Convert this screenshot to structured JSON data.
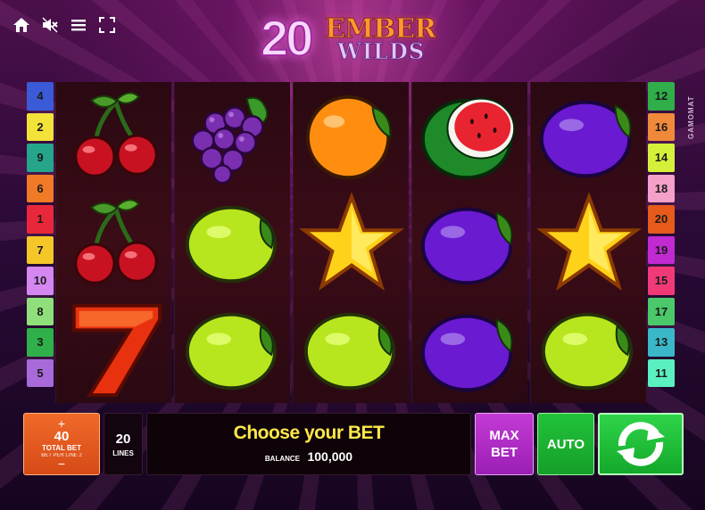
{
  "game": {
    "logo_number": "20",
    "logo_word1": "EMBER",
    "logo_word2": "WILDS",
    "brand": "GAMOMAT"
  },
  "top_icons": [
    "home-icon",
    "mute-icon",
    "menu-icon",
    "fullscreen-icon"
  ],
  "lines_left": [
    {
      "label": "4",
      "color": "#3a5ad8"
    },
    {
      "label": "2",
      "color": "#f2e23a"
    },
    {
      "label": "9",
      "color": "#25a58a"
    },
    {
      "label": "6",
      "color": "#f07a25"
    },
    {
      "label": "1",
      "color": "#e8283a"
    },
    {
      "label": "7",
      "color": "#f5c628"
    },
    {
      "label": "10",
      "color": "#d487f0"
    },
    {
      "label": "8",
      "color": "#8fe07a"
    },
    {
      "label": "3",
      "color": "#2fb04a"
    },
    {
      "label": "5",
      "color": "#a86ad8"
    }
  ],
  "lines_right": [
    {
      "label": "12",
      "color": "#2fae4a"
    },
    {
      "label": "16",
      "color": "#f08a3a"
    },
    {
      "label": "14",
      "color": "#d6f03a"
    },
    {
      "label": "18",
      "color": "#f4a0c8"
    },
    {
      "label": "20",
      "color": "#e65a1a"
    },
    {
      "label": "19",
      "color": "#c02ad0"
    },
    {
      "label": "15",
      "color": "#f03a78"
    },
    {
      "label": "17",
      "color": "#4ac86a"
    },
    {
      "label": "13",
      "color": "#3ab8c8"
    },
    {
      "label": "11",
      "color": "#5af0c0"
    }
  ],
  "reels": [
    [
      "cherry",
      "cherry",
      "seven"
    ],
    [
      "grapes",
      "lemon",
      "lemon"
    ],
    [
      "orange",
      "star",
      "lemon"
    ],
    [
      "watermelon",
      "plum",
      "plum"
    ],
    [
      "plum",
      "star",
      "lemon"
    ]
  ],
  "bottom": {
    "bet_plus": "+",
    "bet_value": "40",
    "bet_label": "TOTAL BET",
    "bet_sub": "BET PER LINE  2",
    "bet_minus": "−",
    "lines_value": "20",
    "lines_label": "LINES",
    "message": "Choose your BET",
    "balance_label": "BALANCE",
    "balance_value": "100,000",
    "maxbet_label": "MAX BET",
    "auto_label": "AUTO",
    "spin_icon": "refresh-arrows-icon"
  }
}
